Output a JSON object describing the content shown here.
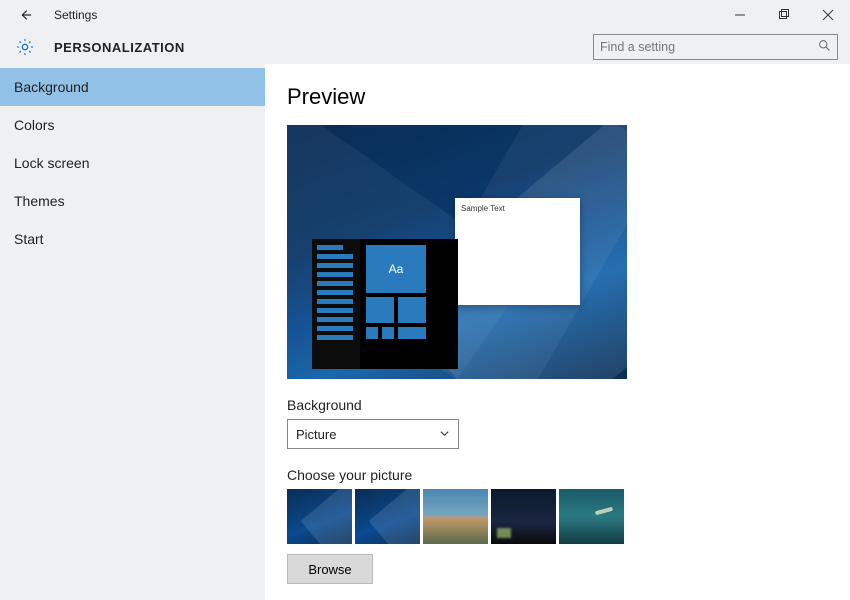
{
  "titlebar": {
    "title": "Settings"
  },
  "header": {
    "category": "PERSONALIZATION"
  },
  "search": {
    "placeholder": "Find a setting"
  },
  "sidebar": {
    "items": [
      {
        "label": "Background",
        "active": true
      },
      {
        "label": "Colors"
      },
      {
        "label": "Lock screen"
      },
      {
        "label": "Themes"
      },
      {
        "label": "Start"
      }
    ]
  },
  "main": {
    "preview_heading": "Preview",
    "sample_text": "Sample Text",
    "start_tile_text": "Aa",
    "background_label": "Background",
    "background_dropdown": {
      "selected": "Picture"
    },
    "choose_label": "Choose your picture",
    "browse_label": "Browse"
  }
}
